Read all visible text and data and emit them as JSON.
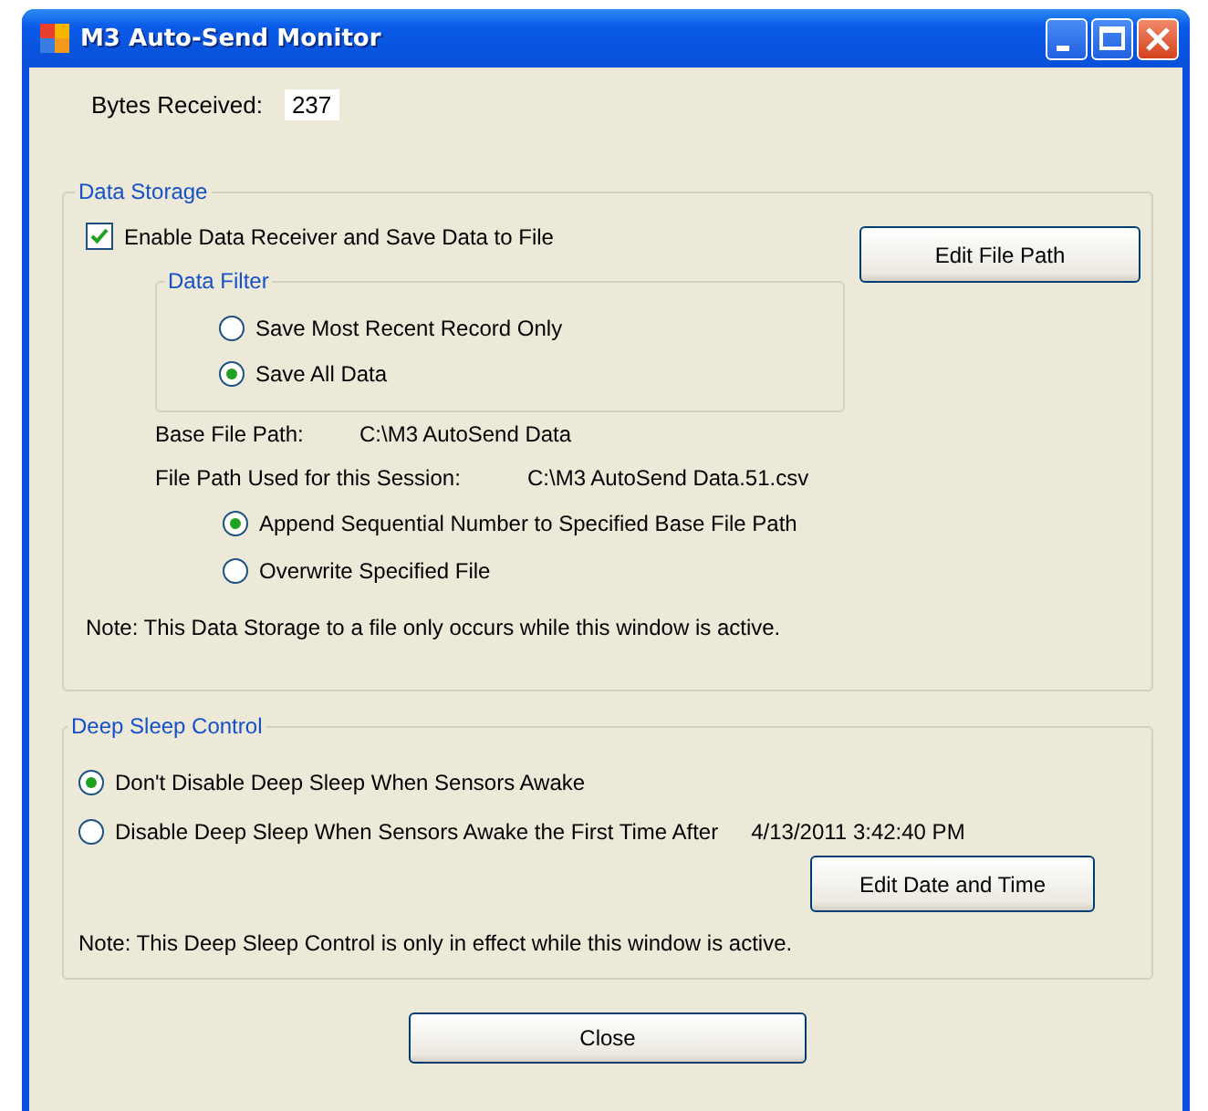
{
  "window": {
    "title": "M3 Auto-Send Monitor"
  },
  "bytes_received": {
    "label": "Bytes Received:",
    "value": "237"
  },
  "data_storage": {
    "title": "Data Storage",
    "enable": {
      "label": "Enable Data Receiver and Save Data to File",
      "checked": true
    },
    "edit_button": "Edit File Path",
    "data_filter": {
      "title": "Data Filter",
      "options": [
        {
          "label": "Save Most Recent Record Only",
          "selected": false
        },
        {
          "label": "Save All Data",
          "selected": true
        }
      ]
    },
    "base_path": {
      "label": "Base File Path:",
      "value": "C:\\M3 AutoSend Data"
    },
    "session_path": {
      "label": "File Path Used for this Session:",
      "value": "C:\\M3 AutoSend Data.51.csv"
    },
    "file_mode": [
      {
        "label": "Append Sequential Number to Specified Base File Path",
        "selected": true
      },
      {
        "label": "Overwrite Specified File",
        "selected": false
      }
    ],
    "note": "Note: This Data Storage to a file only occurs while this window is active."
  },
  "deep_sleep": {
    "title": "Deep Sleep Control",
    "options": [
      {
        "label": "Don't Disable Deep Sleep When Sensors Awake",
        "selected": true
      },
      {
        "label": "Disable Deep Sleep When Sensors Awake the First Time After",
        "selected": false
      }
    ],
    "date_time": "4/13/2011 3:42:40 PM",
    "edit_button": "Edit Date and Time",
    "note": "Note: This Deep Sleep Control is only in effect while this window is active."
  },
  "close_button": "Close"
}
